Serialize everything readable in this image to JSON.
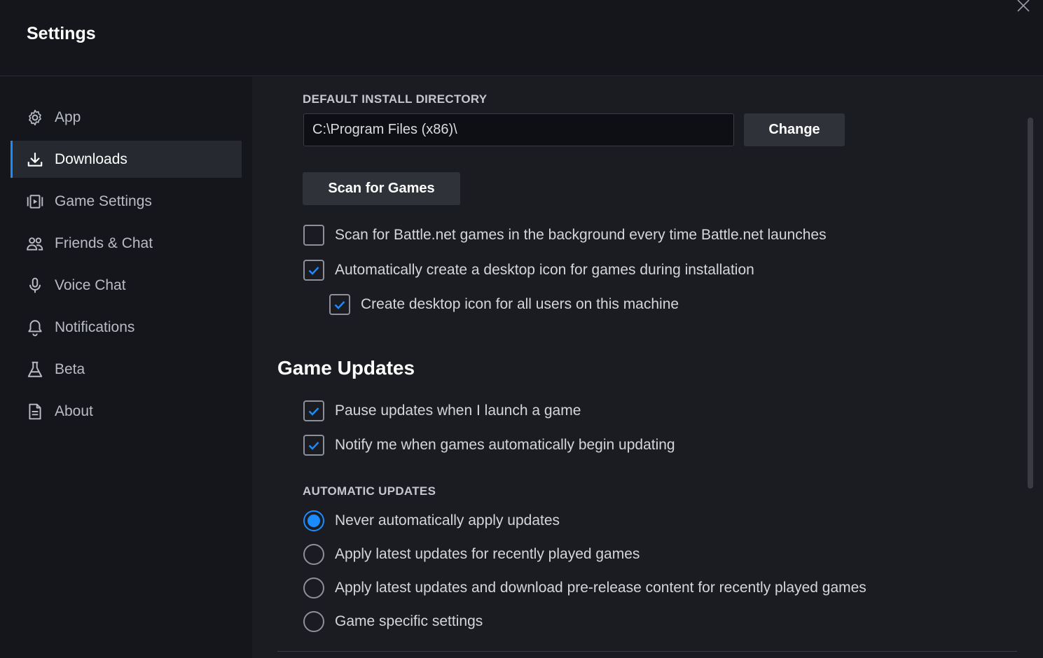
{
  "window": {
    "title": "Settings",
    "close_icon": "close-icon"
  },
  "sidebar": {
    "items": [
      {
        "label": "App",
        "icon": "gear-icon",
        "active": false
      },
      {
        "label": "Downloads",
        "icon": "download-icon",
        "active": true
      },
      {
        "label": "Game Settings",
        "icon": "game-settings-icon",
        "active": false
      },
      {
        "label": "Friends & Chat",
        "icon": "friends-icon",
        "active": false
      },
      {
        "label": "Voice Chat",
        "icon": "microphone-icon",
        "active": false
      },
      {
        "label": "Notifications",
        "icon": "bell-icon",
        "active": false
      },
      {
        "label": "Beta",
        "icon": "flask-icon",
        "active": false
      },
      {
        "label": "About",
        "icon": "document-icon",
        "active": false
      }
    ]
  },
  "downloads": {
    "install_dir_label": "DEFAULT INSTALL DIRECTORY",
    "install_dir_value": "C:\\Program Files (x86)\\",
    "change_label": "Change",
    "scan_label": "Scan for Games",
    "options": [
      {
        "label": "Scan for Battle.net games in the background every time Battle.net launches",
        "checked": false
      },
      {
        "label": "Automatically create a desktop icon for games during installation",
        "checked": true
      },
      {
        "label": "Create desktop icon for all users on this machine",
        "checked": true
      }
    ]
  },
  "game_updates": {
    "heading": "Game Updates",
    "options": [
      {
        "label": "Pause updates when I launch a game",
        "checked": true
      },
      {
        "label": "Notify me when games automatically begin updating",
        "checked": true
      }
    ],
    "auto_label": "AUTOMATIC UPDATES",
    "auto_options": [
      {
        "label": "Never automatically apply updates",
        "selected": true
      },
      {
        "label": "Apply latest updates for recently played games",
        "selected": false
      },
      {
        "label": "Apply latest updates and download pre-release content for recently played games",
        "selected": false
      },
      {
        "label": "Game specific settings",
        "selected": false
      }
    ]
  },
  "colors": {
    "accent": "#148eff",
    "background": "#1b1c22",
    "sidebar": "#15161b"
  }
}
